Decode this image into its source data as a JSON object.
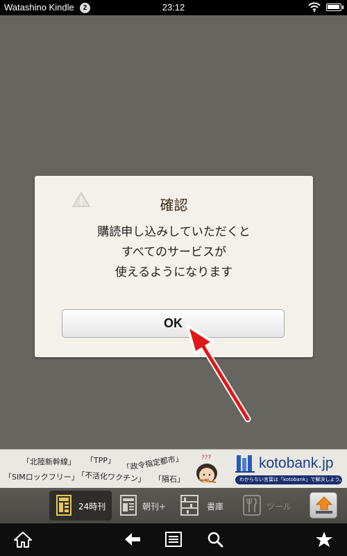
{
  "status_bar": {
    "app_name": "Watashino Kindle",
    "notification_count": "2",
    "time": "23:12",
    "battery_level": 1.0
  },
  "dialog": {
    "title": "確認",
    "message_lines": [
      "購読申し込みしていただくと",
      "すべてのサービスが",
      "使えるようになります"
    ],
    "ok_label": "OK",
    "icon": "warning-icon"
  },
  "ad": {
    "tags": [
      "「北陸新幹線」",
      "「TPP」",
      "「政令指定都市」",
      "「SIMロックフリー」",
      "「不活化ワクチン」",
      "「隕石」"
    ],
    "mascot_text": "???",
    "logo_text": "kotobank.jp",
    "logo_subtext": "わからない言葉は「kotobank」で解決しよう。"
  },
  "toolbar": {
    "items": [
      {
        "label": "24時刊",
        "icon": "newspaper-icon"
      },
      {
        "label": "朝刊+",
        "icon": "document-icon"
      },
      {
        "label": "書庫",
        "icon": "bookshelf-icon"
      },
      {
        "label": "ツール",
        "icon": "fork-knife-icon"
      }
    ],
    "active_index": 0,
    "upload_icon": "up-arrow-icon"
  },
  "nav": {
    "icons": [
      "home-icon",
      "back-icon",
      "menu-icon",
      "search-icon",
      "star-icon"
    ]
  },
  "colors": {
    "background": "#676560",
    "arrow": "#e01818",
    "logo": "#1a3d8a"
  }
}
